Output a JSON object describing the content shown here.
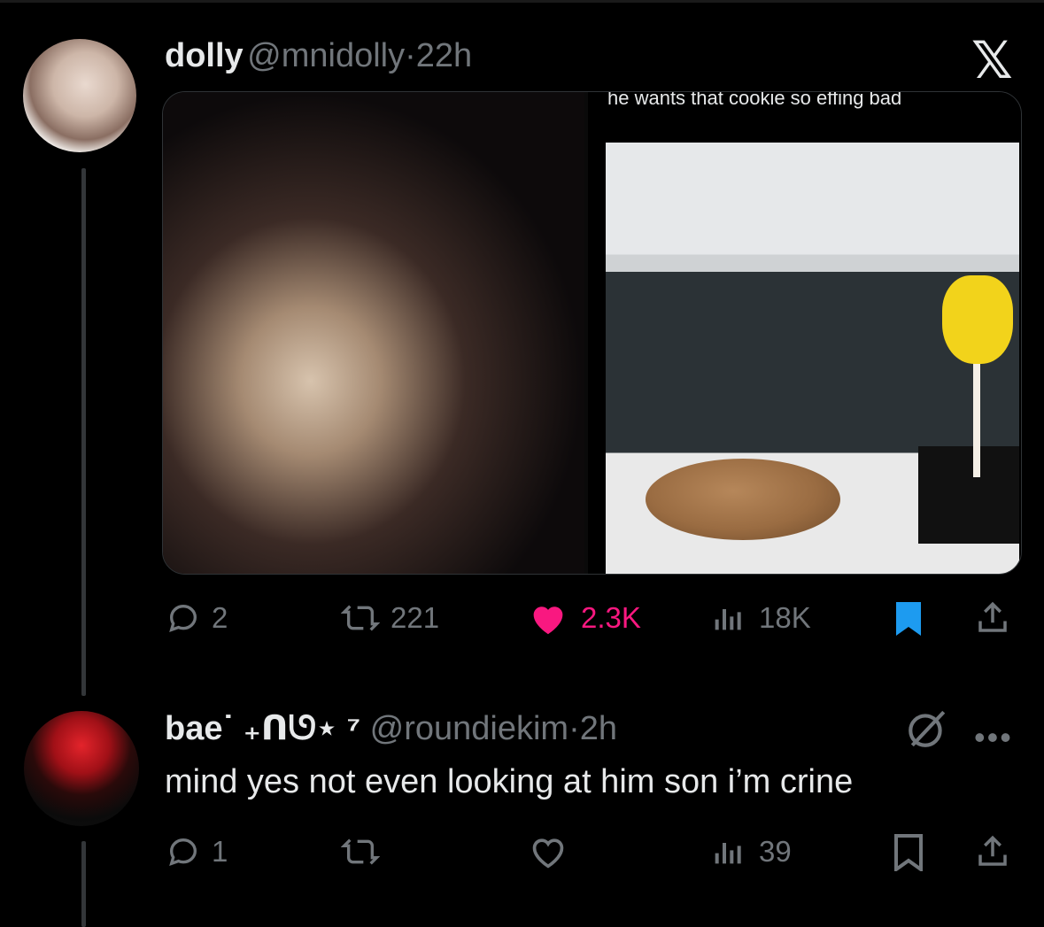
{
  "post": {
    "display_name": "dolly",
    "handle": "@mnidolly",
    "dot": "·",
    "time": "22h",
    "media_caption": "he wants that cookie so effing bad",
    "stats": {
      "replies": "2",
      "reposts": "221",
      "likes": "2.3K",
      "views": "18K"
    },
    "liked": true,
    "bookmarked": true,
    "like_color": "#f91880",
    "bookmark_color": "#1d9bf0"
  },
  "reply": {
    "display_name": "bae˙ ₊ᑎᘎ⋆ ⁷",
    "handle": "@roundiekim",
    "dot": "·",
    "time": "2h",
    "text": "mind yes not even looking at him son i’m crine",
    "stats": {
      "replies": "1",
      "views": "39"
    }
  },
  "logo": "𝕏",
  "icons": [
    "x-logo-icon",
    "reply-icon",
    "repost-icon",
    "like-icon",
    "views-icon",
    "bookmark-icon",
    "share-icon",
    "grok-icon",
    "more-icon"
  ]
}
